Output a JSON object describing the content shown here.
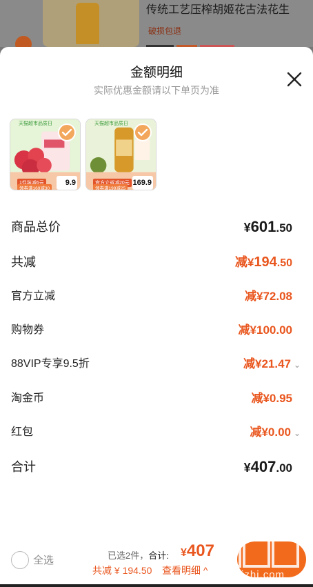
{
  "background": {
    "product_title": "传统工艺压榨胡姬花古法花生",
    "product_sub": "破损包退"
  },
  "sheet": {
    "title": "金额明细",
    "subtitle": "实际优惠金额请以下单页为准"
  },
  "products": [
    {
      "banner": "天猫超市品质日",
      "tag1": "1件装减6元",
      "tag2": "领券满169减30",
      "price": "9.9"
    },
    {
      "banner": "天猫超市品质日",
      "tag1": "官方立省减20元",
      "tag2": "领券满199减25",
      "price": "169.9"
    }
  ],
  "rows": {
    "total_label": "商品总价",
    "total_cur": "¥",
    "total_int": "601",
    "total_dec": ".50",
    "reduce_label": "共减",
    "reduce_prefix": "减",
    "reduce_cur": "¥",
    "reduce_int": "194",
    "reduce_dec": ".50",
    "official_label": "官方立减",
    "official_val": "减¥72.08",
    "coupon_label": "购物券",
    "coupon_val": "减¥100.00",
    "vip_label": "88VIP专享9.5折",
    "vip_val": "减¥21.47",
    "coin_label": "淘金币",
    "coin_val": "减¥0.95",
    "redpack_label": "红包",
    "redpack_val": "减¥0.00",
    "sum_label": "合计",
    "sum_cur": "¥",
    "sum_int": "407",
    "sum_dec": ".00"
  },
  "bottom": {
    "select_all": "全选",
    "selected": "已选2件，",
    "total_prefix": "合计:",
    "price_cur": "¥",
    "price": "407",
    "discount": "共减 ¥ 194.50",
    "detail_link": "查看明细 ^",
    "watermark": "zhizhizhi.com"
  },
  "colors": {
    "accent": "#e9561e",
    "checked": "#f3a75c"
  }
}
